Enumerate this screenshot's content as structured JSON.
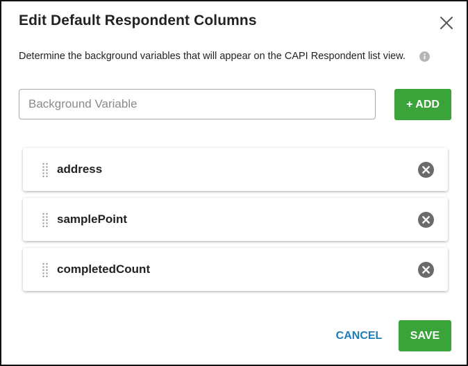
{
  "dialog": {
    "title": "Edit Default Respondent Columns",
    "description": "Determine the background variables that will appear on the CAPI Respondent list view.",
    "close_icon": "close-icon",
    "info_icon": "info-icon"
  },
  "input": {
    "value": "",
    "placeholder": "Background Variable"
  },
  "add_button": {
    "label": "+ ADD"
  },
  "columns": {
    "items": [
      {
        "label": "address"
      },
      {
        "label": "samplePoint"
      },
      {
        "label": "completedCount"
      }
    ],
    "drag_icon": "drag-handle-icon",
    "remove_icon": "remove-circle-icon"
  },
  "footer": {
    "cancel_label": "CANCEL",
    "save_label": "SAVE"
  },
  "colors": {
    "primary_green": "#3aa33a",
    "link_blue": "#1c7db8",
    "icon_gray": "#6b6b6b"
  }
}
